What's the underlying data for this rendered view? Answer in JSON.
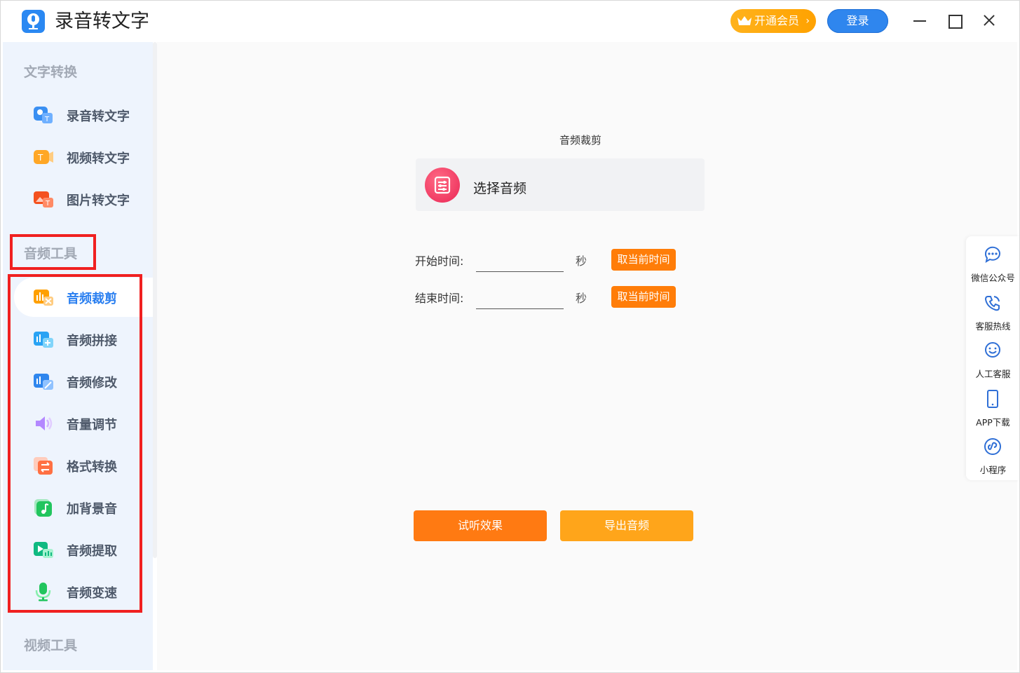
{
  "window": {
    "title": "录音转文字",
    "vip_label": "开通会员",
    "vip_chevron": "›",
    "login_label": "登录",
    "accent": "#2a7ff0"
  },
  "sidebar": {
    "sections": [
      {
        "title": "文字转换",
        "items": [
          {
            "label": "录音转文字",
            "icon": "audio-to-text-icon"
          },
          {
            "label": "视频转文字",
            "icon": "video-to-text-icon"
          },
          {
            "label": "图片转文字",
            "icon": "image-to-text-icon"
          }
        ]
      },
      {
        "title": "音频工具",
        "items": [
          {
            "label": "音频裁剪",
            "icon": "audio-cut-icon",
            "active": true
          },
          {
            "label": "音频拼接",
            "icon": "audio-merge-icon"
          },
          {
            "label": "音频修改",
            "icon": "audio-edit-icon"
          },
          {
            "label": "音量调节",
            "icon": "volume-icon"
          },
          {
            "label": "格式转换",
            "icon": "format-convert-icon"
          },
          {
            "label": "加背景音",
            "icon": "background-music-icon"
          },
          {
            "label": "音频提取",
            "icon": "audio-extract-icon"
          },
          {
            "label": "音频变速",
            "icon": "audio-speed-icon"
          }
        ]
      },
      {
        "title": "视频工具",
        "items": []
      }
    ]
  },
  "main": {
    "heading": "音频裁剪",
    "select_audio": "选择音频",
    "start": {
      "label": "开始时间:",
      "value": "",
      "unit": "秒",
      "button": "取当前时间"
    },
    "end": {
      "label": "结束时间:",
      "value": "",
      "unit": "秒",
      "button": "取当前时间"
    },
    "preview_button": "试听效果",
    "export_button": "导出音频"
  },
  "right_rail": [
    {
      "label": "微信公众号",
      "icon": "wechat-chat-icon"
    },
    {
      "label": "客服热线",
      "icon": "phone-icon"
    },
    {
      "label": "人工客服",
      "icon": "support-agent-icon"
    },
    {
      "label": "APP下载",
      "icon": "mobile-icon"
    },
    {
      "label": "小程序",
      "icon": "mini-program-icon"
    }
  ]
}
